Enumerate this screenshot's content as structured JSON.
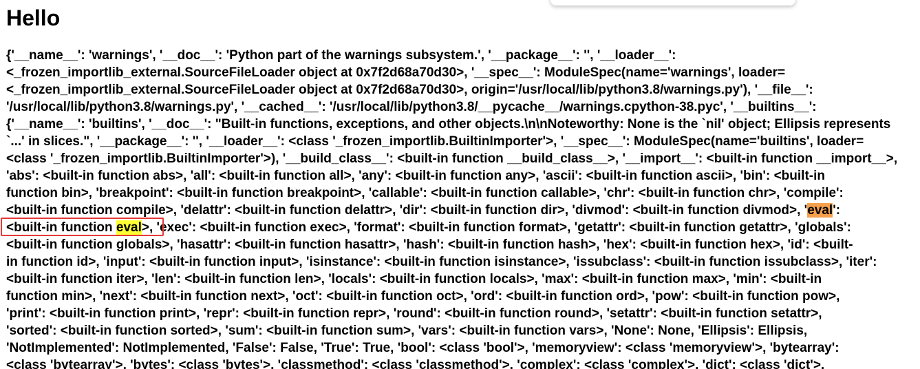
{
  "page": {
    "title": "Hello"
  },
  "dump": {
    "lines": [
      "{'__name__': 'warnings', '__doc__': 'Python part of the warnings subsystem.', '__package__': '', '__loader__':",
      "<_frozen_importlib_external.SourceFileLoader object at 0x7f2d68a70d30>, '__spec__': ModuleSpec(name='warnings', loader=",
      "<_frozen_importlib_external.SourceFileLoader object at 0x7f2d68a70d30>, origin='/usr/local/lib/python3.8/warnings.py'), '__file__':",
      "'/usr/local/lib/python3.8/warnings.py', '__cached__': '/usr/local/lib/python3.8/__pycache__/warnings.cpython-38.pyc', '__builtins__':",
      "{'__name__': 'builtins', '__doc__': \"Built-in functions, exceptions, and other objects.\\n\\nNoteworthy: None is the `nil' object; Ellipsis represents",
      "`...' in slices.\", '__package__': '', '__loader__': <class '_frozen_importlib.BuiltinImporter'>, '__spec__': ModuleSpec(name='builtins', loader=",
      "<class '_frozen_importlib.BuiltinImporter'>), '__build_class__': <built-in function __build_class__>, '__import__': <built-in function __import__>,",
      "'abs': <built-in function abs>, 'all': <built-in function all>, 'any': <built-in function any>, 'ascii': <built-in function ascii>, 'bin': <built-in",
      "function bin>, 'breakpoint': <built-in function breakpoint>, 'callable': <built-in function callable>, 'chr': <built-in function chr>, 'compile':"
    ],
    "line10_prefix": "<built-in function compile>, 'delattr': <built-in function delattr>, 'dir': <built-in function dir>, 'divmod': <built-in function divmod>, '",
    "line10_highlight": "eval",
    "line10_suffix": "':",
    "line11_prefix": "<built-in function ",
    "line11_highlight": "eval",
    "line11_suffix": ">, 'exec': <built-in function exec>, 'format': <built-in function format>, 'getattr': <built-in function getattr>, 'globals':",
    "lines_after": [
      "<built-in function globals>, 'hasattr': <built-in function hasattr>, 'hash': <built-in function hash>, 'hex': <built-in function hex>, 'id': <built-",
      "in function id>, 'input': <built-in function input>, 'isinstance': <built-in function isinstance>, 'issubclass': <built-in function issubclass>, 'iter':",
      "<built-in function iter>, 'len': <built-in function len>, 'locals': <built-in function locals>, 'max': <built-in function max>, 'min': <built-in",
      "function min>, 'next': <built-in function next>, 'oct': <built-in function oct>, 'ord': <built-in function ord>, 'pow': <built-in function pow>,",
      "'print': <built-in function print>, 'repr': <built-in function repr>, 'round': <built-in function round>, 'setattr': <built-in function setattr>,",
      "'sorted': <built-in function sorted>, 'sum': <built-in function sum>, 'vars': <built-in function vars>, 'None': None, 'Ellipsis': Ellipsis,",
      "'NotImplemented': NotImplemented, 'False': False, 'True': True, 'bool': <class 'bool'>, 'memoryview': <class 'memoryview'>, 'bytearray':",
      "<class 'bytearray'>, 'bytes': <class 'bytes'>, 'classmethod': <class 'classmethod'>, 'complex': <class 'complex'>, 'dict': <class 'dict'>,"
    ]
  },
  "colors": {
    "highlight_current": "#f5a04c",
    "highlight_match": "#ffff33",
    "annotation_box": "#e53935"
  }
}
